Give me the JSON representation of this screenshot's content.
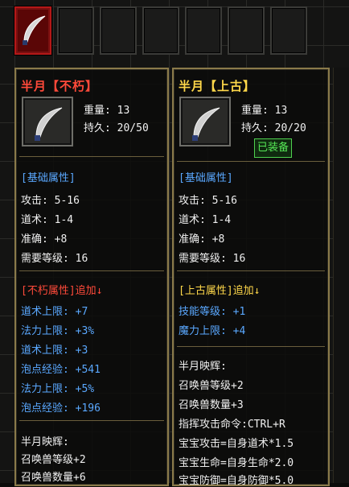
{
  "colors": {
    "immortal_title": "#ff3b2f",
    "ancient_title": "#ffd84a",
    "section_blue": "#5aa8ff",
    "equipped_green": "#56e856",
    "panel_border": "#8a7a4a"
  },
  "icons": {
    "weapon": "curved-blade-icon"
  },
  "left": {
    "title": "半月【不朽】",
    "weight": "重量: 13",
    "durability": "持久: 20/50",
    "base_header": "[基础属性]",
    "base": [
      "攻击: 5-16",
      "道术: 1-4",
      "准确: +8",
      "需要等级: 16"
    ],
    "extra_header": "[不朽属性]追加↓",
    "extra": [
      "道术上限: +7",
      "法力上限: +3%",
      "道术上限: +3",
      "泡点经验: +541",
      "法力上限: +5%",
      "泡点经验: +196"
    ],
    "glow_header": "半月映辉:",
    "glow": [
      "召唤兽等级+2",
      "召唤兽数量+6"
    ]
  },
  "right": {
    "title": "半月【上古】",
    "weight": "重量: 13",
    "durability": "持久: 20/20",
    "equipped": "已装备",
    "base_header": "[基础属性]",
    "base": [
      "攻击: 5-16",
      "道术: 1-4",
      "准确: +8",
      "需要等级: 16"
    ],
    "extra_header": "[上古属性]追加↓",
    "extra": [
      "技能等级: +1",
      "魔力上限: +4"
    ],
    "glow_header": "半月映辉:",
    "glow": [
      "召唤兽等级+2",
      "召唤兽数量+3",
      "指挥攻击命令:CTRL+R",
      "宝宝攻击=自身道术*1.5",
      "宝宝生命=自身生命*2.0",
      "宝宝防御=自身防御*5.0"
    ]
  }
}
